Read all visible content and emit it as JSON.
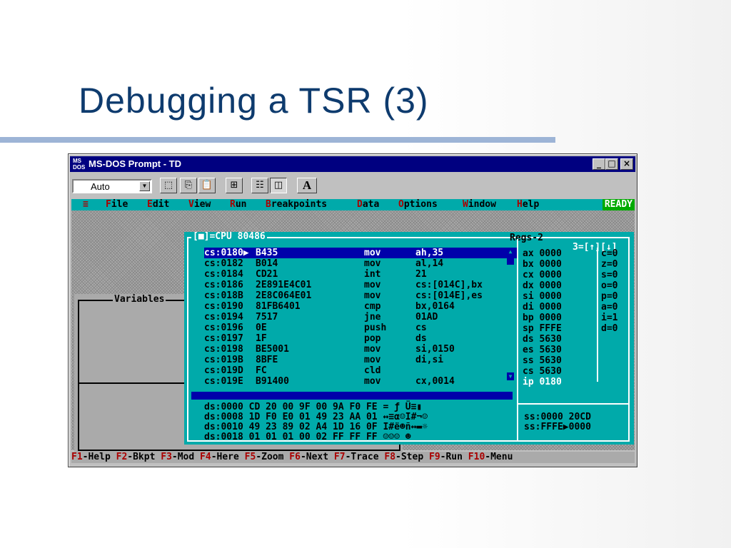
{
  "slide": {
    "title": "Debugging a TSR (3)"
  },
  "window": {
    "title": "MS-DOS Prompt - TD",
    "icon_text_top": "MS",
    "icon_text_bottom": "DOS",
    "minimize": "_",
    "maximize": "□",
    "close": "×"
  },
  "toolbar": {
    "font_size_value": "Auto",
    "dropdown_arrow": "▼",
    "font_button": "A"
  },
  "menu": {
    "system": "≡",
    "items": [
      {
        "hot": "F",
        "rest": "ile"
      },
      {
        "hot": "E",
        "rest": "dit"
      },
      {
        "hot": "V",
        "rest": "iew"
      },
      {
        "hot": "R",
        "rest": "un"
      },
      {
        "hot": "B",
        "rest": "reakpoints"
      },
      {
        "hot": "D",
        "rest": "ata"
      },
      {
        "hot": "O",
        "rest": "ptions"
      },
      {
        "hot": "W",
        "rest": "indow"
      },
      {
        "hot": "H",
        "rest": "elp"
      }
    ],
    "status": "READY"
  },
  "variables_window": {
    "title": "Variables"
  },
  "cpu_window": {
    "title": "[■]=CPU 80486",
    "regs_title": "Regs-2",
    "regs_controls": "3=[↑][↓]",
    "code": [
      {
        "addr": "cs:0180▶",
        "bytes": "B435",
        "op": "mov",
        "args": "ah,35"
      },
      {
        "addr": "cs:0182",
        "bytes": "B014",
        "op": "mov",
        "args": "al,14"
      },
      {
        "addr": "cs:0184",
        "bytes": "CD21",
        "op": "int",
        "args": "21"
      },
      {
        "addr": "cs:0186",
        "bytes": "2E891E4C01",
        "op": "mov",
        "args": "cs:[014C],bx"
      },
      {
        "addr": "cs:018B",
        "bytes": "2E8C064E01",
        "op": "mov",
        "args": "cs:[014E],es"
      },
      {
        "addr": "cs:0190",
        "bytes": "81FB6401",
        "op": "cmp",
        "args": "bx,0164"
      },
      {
        "addr": "cs:0194",
        "bytes": "7517",
        "op": "jne",
        "args": "01AD"
      },
      {
        "addr": "cs:0196",
        "bytes": "0E",
        "op": "push",
        "args": "cs"
      },
      {
        "addr": "cs:0197",
        "bytes": "1F",
        "op": "pop",
        "args": "ds"
      },
      {
        "addr": "cs:0198",
        "bytes": "BE5001",
        "op": "mov",
        "args": "si,0150"
      },
      {
        "addr": "cs:019B",
        "bytes": "8BFE",
        "op": "mov",
        "args": "di,si"
      },
      {
        "addr": "cs:019D",
        "bytes": "FC",
        "op": "cld",
        "args": ""
      },
      {
        "addr": "cs:019E",
        "bytes": "B91400",
        "op": "mov",
        "args": "cx,0014"
      }
    ],
    "registers": [
      "ax 0000",
      "bx 0000",
      "cx 0000",
      "dx 0000",
      "si 0000",
      "di 0000",
      "bp 0000",
      "sp FFFE",
      "ds 5630",
      "es 5630",
      "ss 5630",
      "cs 5630",
      "ip 0180"
    ],
    "flags": [
      "c=0",
      "z=0",
      "s=0",
      "o=0",
      "p=0",
      "a=0",
      "i=1",
      "d=0"
    ],
    "dump": [
      "ds:0000 CD 20 00 9F 00 9A F0 FE = ƒ Ü≡▮",
      "ds:0008 1D F0 E0 01 49 23 AA 01 ↔≡α☺I#¬☺",
      "ds:0010 49 23 89 02 A4 1D 16 0F I#ë☻ñ↔▬☼",
      "ds:0018 01 01 01 00 02 FF FF FF ☺☺☺ ☻"
    ],
    "stack": [
      "ss:0000 20CD",
      "ss:FFFE▶0000"
    ]
  },
  "statusbar": [
    {
      "key": "F1",
      "label": "-Help"
    },
    {
      "key": "F2",
      "label": "-Bkpt"
    },
    {
      "key": "F3",
      "label": "-Mod"
    },
    {
      "key": "F4",
      "label": "-Here"
    },
    {
      "key": "F5",
      "label": "-Zoom"
    },
    {
      "key": "F6",
      "label": "-Next"
    },
    {
      "key": "F7",
      "label": "-Trace"
    },
    {
      "key": "F8",
      "label": "-Step"
    },
    {
      "key": "F9",
      "label": "-Run"
    },
    {
      "key": "F10",
      "label": "-Menu"
    }
  ],
  "colors": {
    "title": "#0e3b6e",
    "dos_cyan": "#00aaaa",
    "dos_blue": "#0000aa",
    "dos_red": "#aa0000",
    "ready_green": "#00aa00"
  }
}
